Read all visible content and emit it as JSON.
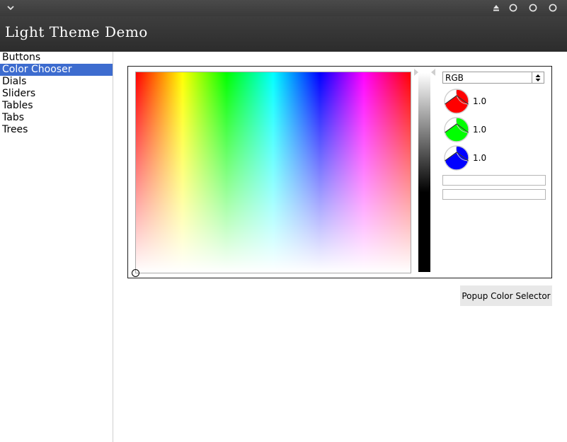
{
  "app": {
    "title": "Light Theme Demo"
  },
  "sidebar": {
    "items": [
      {
        "label": "Buttons",
        "selected": false
      },
      {
        "label": "Color Chooser",
        "selected": true
      },
      {
        "label": "Dials",
        "selected": false
      },
      {
        "label": "Sliders",
        "selected": false
      },
      {
        "label": "Tables",
        "selected": false
      },
      {
        "label": "Tabs",
        "selected": false
      },
      {
        "label": "Trees",
        "selected": false
      }
    ]
  },
  "chooser": {
    "model": "RGB",
    "channels": [
      {
        "name": "red",
        "value": "1.0",
        "color": "#ff0000"
      },
      {
        "name": "green",
        "value": "1.0",
        "color": "#00ff00"
      },
      {
        "name": "blue",
        "value": "1.0",
        "color": "#0000ff"
      }
    ],
    "field1_value": "",
    "field2_value": ""
  },
  "popup_button": {
    "label": "Popup Color Selector"
  },
  "colors": {
    "accent": "#3d6ccf",
    "header": "#333333"
  }
}
